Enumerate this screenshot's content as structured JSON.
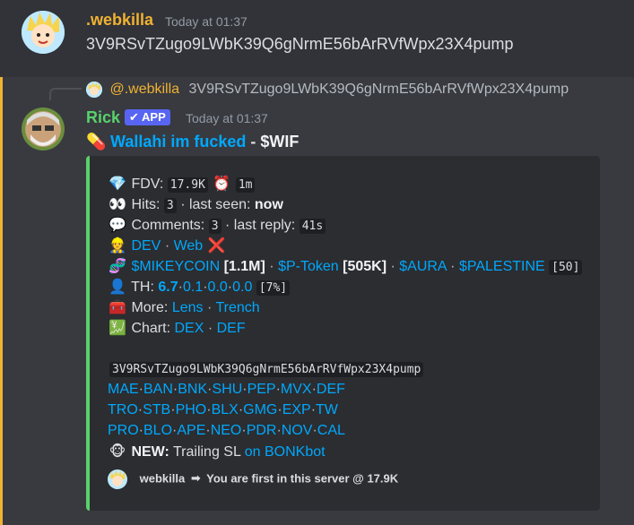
{
  "msg1": {
    "username": ".webkilla",
    "username_color": "#f0b232",
    "timestamp": "Today at 01:37",
    "content": "3V9RSvTZugo9LWbK39Q6gNrmE56bArRVfWpx23X4pump"
  },
  "reply": {
    "username": "@.webkilla",
    "content": "3V9RSvTZugo9LWbK39Q6gNrmE56bArRVfWpx23X4pump"
  },
  "msg2": {
    "username": "Rick",
    "username_color": "#58d26a",
    "badge": "✔ APP",
    "timestamp": "Today at 01:37",
    "title_icon": "pill-icon",
    "title_link": "Wallahi im fucked",
    "title_sep": " - ",
    "title_ticker": "$WIF"
  },
  "embed": {
    "accent_color": "#58d26a",
    "fdv_label": "FDV:",
    "fdv_value": "17.9K",
    "age_value": "1m",
    "hits_label": "Hits:",
    "hits_value": "3",
    "last_seen_label": "· last seen:",
    "last_seen_value": "now",
    "comments_label": "Comments:",
    "comments_value": "3",
    "last_reply_label": "· last reply:",
    "last_reply_value": "41s",
    "dev_label": "DEV",
    "web_label": "Web",
    "related": [
      {
        "name": "$MIKEYCOIN",
        "mc": "[1.1M]"
      },
      {
        "name": "$P-Token",
        "mc": "[505K]"
      },
      {
        "name": "$AURA",
        "mc": ""
      },
      {
        "name": "$PALESTINE",
        "mc": ""
      }
    ],
    "related_count": "[50]",
    "th_label": "TH:",
    "th_values": [
      "6.7",
      "0.1",
      "0.0",
      "0.0"
    ],
    "th_total": "[7%]",
    "more_label": "More:",
    "more_links": [
      "Lens",
      "Trench"
    ],
    "chart_label": "Chart:",
    "chart_links": [
      "DEX",
      "DEF"
    ],
    "contract": "3V9RSvTZugo9LWbK39Q6gNrmE56bArRVfWpx23X4pump",
    "links_row1": [
      "MAE",
      "BAN",
      "BNK",
      "SHU",
      "PEP",
      "MVX",
      "DEF"
    ],
    "links_row2": [
      "TRO",
      "STB",
      "PHO",
      "BLX",
      "GMG",
      "EXP",
      "TW"
    ],
    "links_row3": [
      "PRO",
      "BLO",
      "APE",
      "NEO",
      "PDR",
      "NOV",
      "CAL"
    ],
    "new_label": "NEW:",
    "new_text": "Trailing SL",
    "new_link": "on BONKbot",
    "footer_user": "webkilla",
    "footer_arrow": "➡",
    "footer_text": "You are first in this server @ 17.9K"
  },
  "icons": {
    "fdv": "gem-icon",
    "age": "clock-icon",
    "hits": "eyes-icon",
    "comments": "speech-bubble-icon",
    "dev": "person-icon",
    "web_status": "cross-mark-icon",
    "related": "dna-icon",
    "th": "silhouette-icon",
    "more": "toolbox-icon",
    "chart": "yen-chart-icon",
    "new": "monkey-icon"
  }
}
